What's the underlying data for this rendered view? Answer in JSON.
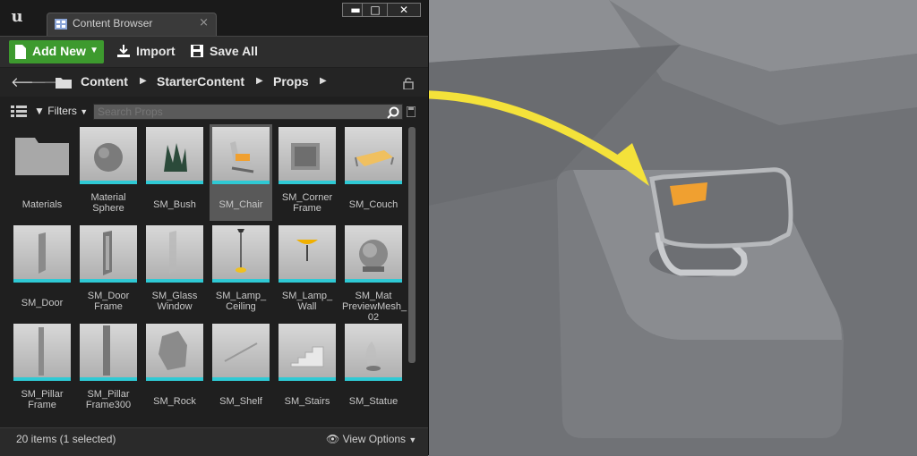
{
  "window": {
    "tab_label": "Content Browser",
    "tab_close": "×",
    "minimize": "▬",
    "maximize": "□",
    "close": "✕"
  },
  "toolbar": {
    "add_new_label": "Add New",
    "import_label": "Import",
    "save_all_label": "Save All"
  },
  "breadcrumb": [
    "Content",
    "StarterContent",
    "Props"
  ],
  "search": {
    "filters_label": "Filters",
    "placeholder": "Search Props"
  },
  "assets": [
    [
      "Materials",
      "folder"
    ],
    [
      "Material Sphere",
      "sphere"
    ],
    [
      "SM_Bush",
      "bush"
    ],
    [
      "SM_Chair",
      "chair"
    ],
    [
      "SM_Corner Frame",
      "box"
    ],
    [
      "SM_Couch",
      "couch"
    ],
    [
      "SM_Door",
      "panel"
    ],
    [
      "SM_Door Frame",
      "frame"
    ],
    [
      "SM_Glass Window",
      "glass"
    ],
    [
      "SM_Lamp_ Ceiling",
      "lampc"
    ],
    [
      "SM_Lamp_ Wall",
      "lampw"
    ],
    [
      "SM_Mat PreviewMesh_ 02",
      "ball"
    ],
    [
      "SM_Pillar Frame",
      "pillar"
    ],
    [
      "SM_Pillar Frame300",
      "pillar2"
    ],
    [
      "SM_Rock",
      "rock"
    ],
    [
      "SM_Shelf",
      "shelf"
    ],
    [
      "SM_Stairs",
      "stairs"
    ],
    [
      "SM_Statue",
      "statue"
    ]
  ],
  "selected_asset": "SM_Chair",
  "status": {
    "summary": "20 items (1 selected)",
    "view_options_label": "View Options"
  },
  "colors": {
    "add_new": "#3d9a2e",
    "thumb_strip": "#2fc9d4",
    "arrow": "#f4e23a",
    "chair_seat": "#f0a030"
  }
}
